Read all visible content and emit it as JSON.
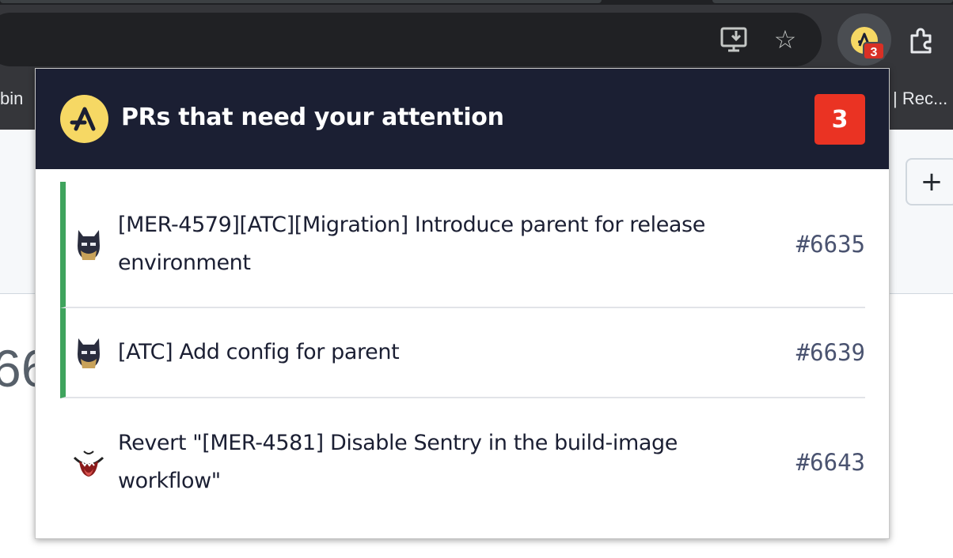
{
  "browser": {
    "bookmark_left_label": "bin",
    "bookmark_right_label": "| Rec...",
    "extension_badge": "3"
  },
  "page": {
    "plus_label": "+",
    "partial_number": "66"
  },
  "popup": {
    "title": "PRs that need your attention",
    "count": "3",
    "prs": [
      {
        "title": "[MER-4579][ATC][Migration] Introduce parent for release environment",
        "number": "#6635",
        "highlighted": true,
        "avatar": "batman-avatar"
      },
      {
        "title": "[ATC] Add config for parent",
        "number": "#6639",
        "highlighted": true,
        "avatar": "batman-avatar"
      },
      {
        "title": "Revert \"[MER-4581] Disable Sentry in the build-image workflow\"",
        "number": "#6643",
        "highlighted": false,
        "avatar": "tongue-face-avatar"
      }
    ]
  },
  "colors": {
    "header_bg": "#1b1f33",
    "badge_red": "#ea3323",
    "highlight_green": "#3fa45d",
    "logo_yellow": "#f6d864"
  }
}
